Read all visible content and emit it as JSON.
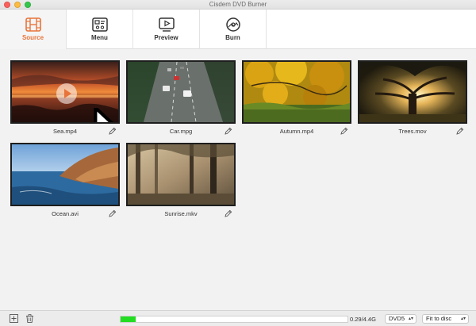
{
  "window": {
    "title": "Cisdem DVD Burner"
  },
  "tabs": [
    {
      "label": "Source",
      "icon": "film-icon",
      "active": true
    },
    {
      "label": "Menu",
      "icon": "menu-template-icon",
      "active": false
    },
    {
      "label": "Preview",
      "icon": "preview-play-icon",
      "active": false
    },
    {
      "label": "Burn",
      "icon": "disc-burn-icon",
      "active": false
    }
  ],
  "media": [
    {
      "name": "Sea.mp4",
      "thumb": "sunset-sea"
    },
    {
      "name": "Car.mpg",
      "thumb": "highway-cars"
    },
    {
      "name": "Autumn.mp4",
      "thumb": "autumn-leaves"
    },
    {
      "name": "Trees.mov",
      "thumb": "sunlit-tree"
    },
    {
      "name": "Ocean.avi",
      "thumb": "ocean-cliffs"
    },
    {
      "name": "Sunrise.mkv",
      "thumb": "misty-forest"
    }
  ],
  "bottom": {
    "capacity": "0.29/4.4G",
    "usage_fraction": 0.066,
    "disc_type": "DVD5",
    "fit_mode": "Fit to disc"
  },
  "colors": {
    "accent": "#e8743b",
    "progress": "#22dd22"
  }
}
